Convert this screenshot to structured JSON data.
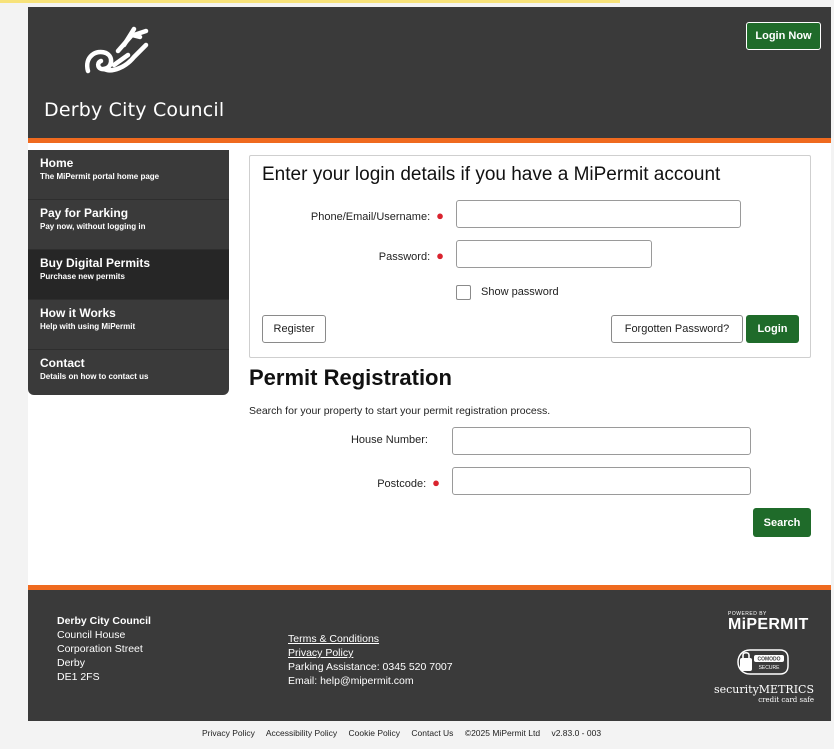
{
  "header": {
    "council_name": "Derby City Council",
    "login_now_label": "Login Now"
  },
  "sidebar": {
    "items": [
      {
        "title": "Home",
        "subtitle": "The MiPermit portal home page"
      },
      {
        "title": "Pay for Parking",
        "subtitle": "Pay now, without logging in"
      },
      {
        "title": "Buy Digital Permits",
        "subtitle": "Purchase new permits"
      },
      {
        "title": "How it Works",
        "subtitle": "Help with using MiPermit"
      },
      {
        "title": "Contact",
        "subtitle": "Details on how to contact us"
      }
    ],
    "active_index": 2
  },
  "login": {
    "heading": "Enter your login details if you have a MiPermit account",
    "username_label": "Phone/Email/Username:",
    "username_value": "",
    "password_label": "Password:",
    "password_value": "",
    "show_password_label": "Show password",
    "register_label": "Register",
    "forgot_label": "Forgotten Password?",
    "login_label": "Login"
  },
  "permit": {
    "heading": "Permit Registration",
    "description": "Search for your property to start your permit registration process.",
    "house_number_label": "House Number:",
    "house_number_value": "",
    "postcode_label": "Postcode:",
    "postcode_value": "",
    "search_label": "Search"
  },
  "footer": {
    "address": [
      "Derby City Council",
      "Council House",
      "Corporation Street",
      "Derby",
      "DE1 2FS"
    ],
    "terms_label": "Terms & Conditions",
    "privacy_label": "Privacy Policy",
    "parking_assistance": "Parking Assistance: 0345 520 7007",
    "email": "Email: help@mipermit.com",
    "powered_by": "POWERED BY",
    "brand": "MiPERMIT",
    "comodo": "COMODO",
    "secure": "SECURE",
    "security_metrics": "securityMETRICS",
    "credit_card_safe": "credit card safe"
  },
  "bottom_links": {
    "privacy_policy": "Privacy Policy",
    "accessibility_policy": "Accessibility Policy",
    "cookie_policy": "Cookie Policy",
    "contact_us": "Contact Us",
    "copyright": "©2025 MiPermit Ltd",
    "version": "v2.83.0 - 003"
  },
  "colors": {
    "header_bg": "#3a3a3a",
    "accent_orange": "#ef6a1f",
    "button_green": "#1f6b2a",
    "required_red": "#d9232e"
  },
  "icons": [
    "derby-ram-logo-icon",
    "comodo-secure-icon"
  ]
}
